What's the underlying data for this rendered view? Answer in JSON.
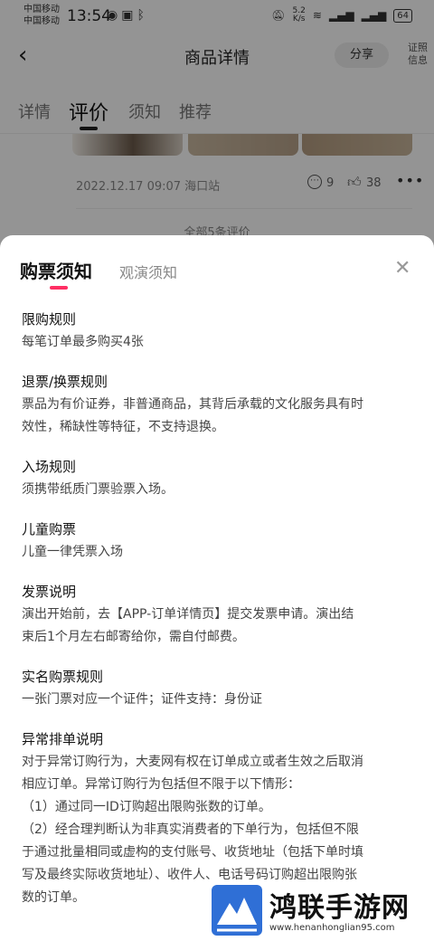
{
  "status_bar": {
    "carrier_1": "中国移动",
    "carrier_2": "中国移动",
    "time": "13:54",
    "speed_value": "5.2",
    "speed_unit": "K/s",
    "battery": "64"
  },
  "navbar": {
    "back_icon": "chevron-left-icon",
    "title": "商品详情",
    "share_label": "分享",
    "cert_label": "证照信息"
  },
  "tabs": [
    {
      "label": "详情"
    },
    {
      "label": "评价"
    },
    {
      "label": "须知"
    },
    {
      "label": "推荐"
    }
  ],
  "review": {
    "meta": "2022.12.17 09:07 海口站",
    "comment_count": "9",
    "like_count": "38",
    "all_reviews_label": "全部5条评价"
  },
  "sheet": {
    "tab_active": "购票须知",
    "tab_inactive": "观演须知",
    "accent_color": "#ff2e63",
    "sections": [
      {
        "title": "限购规则",
        "lines": [
          "每笔订单最多购买4张"
        ]
      },
      {
        "title": "退票/换票规则",
        "lines": [
          "票品为有价证券，非普通商品，其背后承载的文化服务具有时",
          "效性，稀缺性等特征，不支持退换。"
        ]
      },
      {
        "title": "入场规则",
        "lines": [
          "须携带纸质门票验票入场。"
        ]
      },
      {
        "title": "儿童购票",
        "lines": [
          "儿童一律凭票入场"
        ]
      },
      {
        "title": "发票说明",
        "lines": [
          "演出开始前，去【APP-订单详情页】提交发票申请。演出结",
          "束后1个月左右邮寄给你，需自付邮费。"
        ]
      },
      {
        "title": "实名购票规则",
        "lines": [
          "一张门票对应一个证件；证件支持：身份证"
        ]
      },
      {
        "title": "异常排单说明",
        "lines": [
          "对于异常订购行为，大麦网有权在订单成立或者生效之后取消",
          "相应订单。异常订购行为包括但不限于以下情形：",
          "（1）通过同一ID订购超出限购张数的订单。",
          "（2）经合理判断认为非真实消费者的下单行为，包括但不限",
          "于通过批量相同或虚构的支付账号、收货地址（包括下单时填",
          "写及最终实际收货地址）、收件人、电话号码订购超出限购张",
          "数的订单。"
        ]
      }
    ]
  },
  "watermark": {
    "text": "鸿联手游网",
    "url": "www.henanhonglian95.com"
  }
}
